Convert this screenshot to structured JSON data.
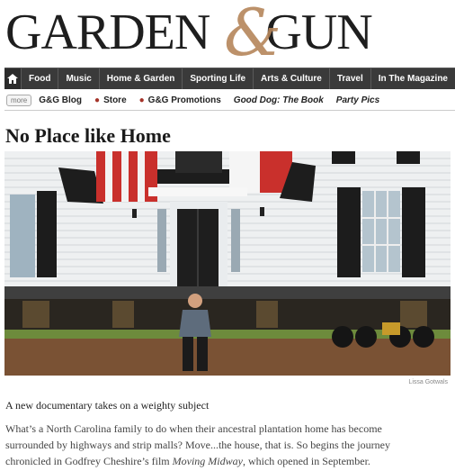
{
  "brand": {
    "left": "GARDEN",
    "amp": "&",
    "right": "GUN",
    "accent": "#b5865a"
  },
  "mainnav": {
    "home_icon": "home-icon",
    "items": [
      "Food",
      "Music",
      "Home & Garden",
      "Sporting Life",
      "Arts & Culture",
      "Travel",
      "In The Magazine"
    ]
  },
  "subnav": {
    "more_label": "more",
    "items": [
      "G&G Blog",
      "Store",
      "G&G Promotions",
      "Good Dog: The Book",
      "Party Pics"
    ]
  },
  "article": {
    "title": "No Place like Home",
    "photo_credit": "Lissa Gotwals",
    "dek": "A new documentary takes on a weighty subject",
    "body_line1": "What’s a North Carolina family to do when their ancestral plantation home has become",
    "body_line2": "surrounded by highways and strip malls? Move...the house, that is. So begins the journey",
    "body_line3_pre": "chronicled in Godfrey Cheshire’s film ",
    "body_film": "Moving Midway",
    "body_line3_post": ", which opened in September."
  }
}
